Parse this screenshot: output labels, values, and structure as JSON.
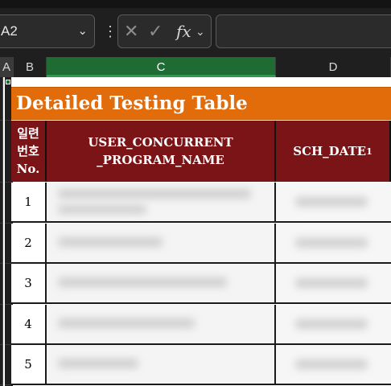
{
  "formula_bar": {
    "name_box": "A2",
    "name_box_chevron": "chevron-down-icon",
    "more_icon": "vertical-ellipsis-icon",
    "cancel_icon": "✕",
    "enter_icon": "✓",
    "function_label": "fx",
    "function_chevron": "chevron-down-icon",
    "formula_value": ""
  },
  "columns": [
    "A",
    "B",
    "C",
    "D"
  ],
  "selected_column": "C",
  "sheet": {
    "title": "Detailed Testing Table",
    "headers": {
      "number": [
        "일련",
        "번호",
        "No."
      ],
      "program": [
        "USER_CONCURRENT",
        "_PROGRAM_NAME"
      ],
      "date_main": "SCH_DATE",
      "date_sub": "1"
    },
    "rows": [
      {
        "no": "1"
      },
      {
        "no": "2"
      },
      {
        "no": "3"
      },
      {
        "no": "4"
      },
      {
        "no": "5"
      }
    ]
  },
  "colors": {
    "title_band": "#e26b0a",
    "header_fill": "#7a1416",
    "selected_column": "#1e6b34"
  }
}
